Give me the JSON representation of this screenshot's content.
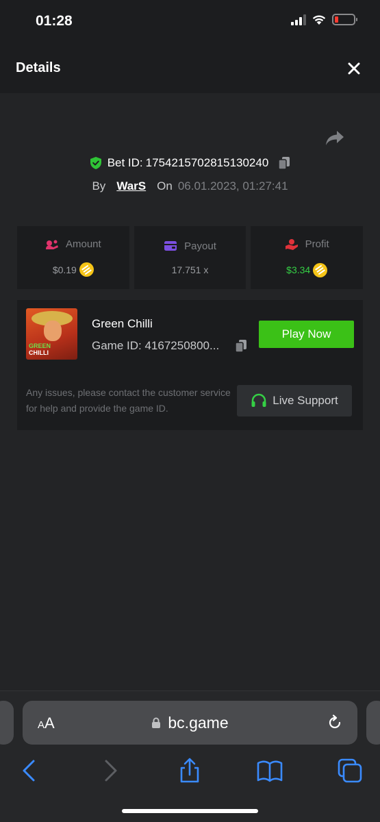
{
  "status_bar": {
    "time": "01:28"
  },
  "header": {
    "title": "Details"
  },
  "bet": {
    "id_label": "Bet ID:",
    "id_value": "1754215702815130240",
    "by_label": "By",
    "user": "WarS",
    "on_label": "On",
    "datetime": "06.01.2023, 01:27:41"
  },
  "stats": {
    "amount": {
      "label": "Amount",
      "value": "$0.19"
    },
    "payout": {
      "label": "Payout",
      "value": "17.751 x"
    },
    "profit": {
      "label": "Profit",
      "value": "$3.34"
    }
  },
  "game": {
    "name": "Green Chilli",
    "id_text": "Game ID: 4167250800...",
    "thumb_line1": "GREEN",
    "thumb_line2": "CHILLI",
    "play_label": "Play Now",
    "issue_text": "Any issues, please contact the customer service for help and provide the game ID.",
    "support_label": "Live Support"
  },
  "browser": {
    "aa_small": "A",
    "aa_large": "A",
    "url": "bc.game"
  },
  "colors": {
    "accent_green": "#3bc117",
    "profit_green": "#35d045",
    "coin": "#f5c417",
    "amount_icon": "#e0336b",
    "payout_icon": "#7b4fe0",
    "profit_icon": "#e0323a",
    "ios_blue": "#3a8bff"
  }
}
